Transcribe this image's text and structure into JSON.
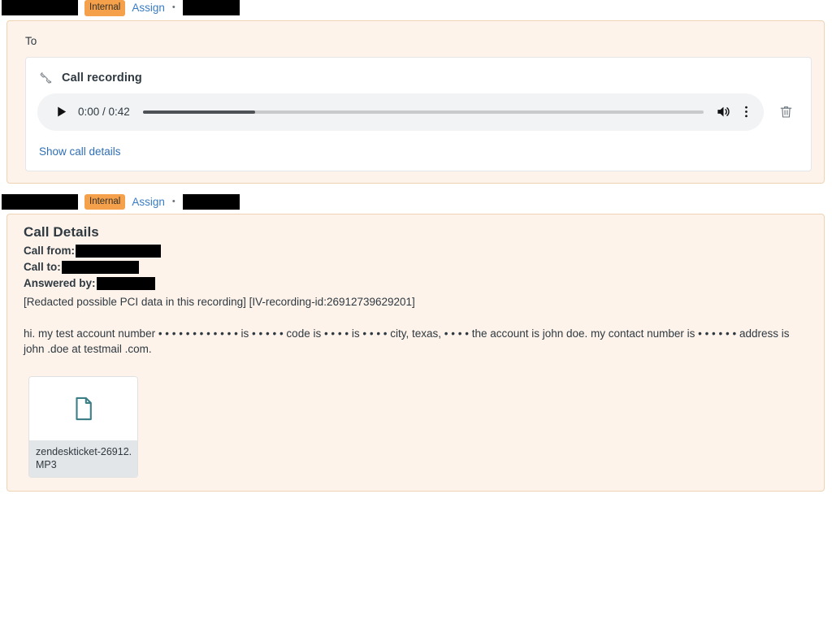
{
  "comment_one": {
    "author_redacted": true,
    "badge": "Internal",
    "assign_link": "Assign",
    "separator": "•",
    "timestamp_redacted": true,
    "to_label": "To",
    "recording": {
      "icon": "phone-handset-icon",
      "title": "Call recording",
      "player": {
        "play_icon": "play-icon",
        "time_readout": "0:00 / 0:42",
        "current_time": "0:00",
        "duration": "0:42",
        "buffered_percent": 20,
        "volume_icon": "volume-high-icon",
        "menu_icon": "kebab-menu-icon"
      },
      "delete_icon": "trash-icon",
      "show_details_link": "Show call details"
    }
  },
  "comment_two": {
    "author_redacted": true,
    "badge": "Internal",
    "assign_link": "Assign",
    "separator": "•",
    "timestamp_redacted": true,
    "details": {
      "title": "Call Details",
      "call_from_label": "Call from:",
      "call_to_label": "Call to:",
      "answered_by_label": "Answered by:",
      "pci_notice": "[Redacted possible PCI data in this recording] [IV-recording-id:26912739629201]",
      "transcript": "hi. my test account number • • • • • • • • • • • • is • • • • • code is • • • • is • • • • city, texas, • • • • the account is john doe. my contact number is • • • • • • address is john .doe at testmail .com.",
      "attachment": {
        "icon": "document-file-icon",
        "filename": "zendeskticket-26912...",
        "filetype": "MP3"
      }
    }
  },
  "colors": {
    "card_background": "#fdf3ea",
    "card_border": "#f0d3b4",
    "badge_internal": "#f5a04a",
    "link": "#3a7cc3",
    "redaction": "#000000",
    "player_background": "#f1f3f4",
    "attachment_icon": "#3c7f86",
    "attachment_meta_background": "#e3e6e8"
  }
}
